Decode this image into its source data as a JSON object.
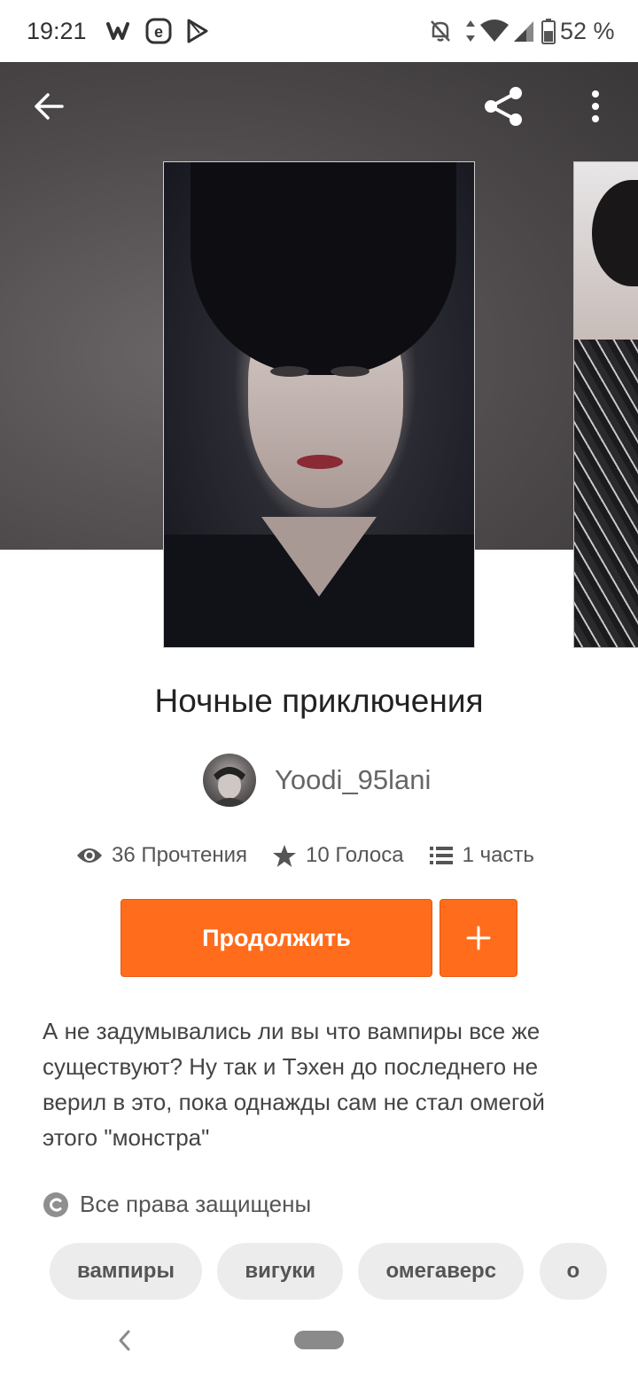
{
  "status_bar": {
    "time": "19:21",
    "battery": "52 %",
    "icons": [
      "wattpad-icon",
      "e-app-icon",
      "play-store-icon",
      "bell-off-icon",
      "data-arrows-icon",
      "wifi-icon",
      "signal-icon",
      "battery-icon"
    ]
  },
  "header": {
    "back_icon": "arrow-left-icon",
    "share_icon": "share-icon",
    "menu_icon": "more-vertical-icon"
  },
  "story": {
    "title": "Ночные приключения",
    "author": "Yoodi_95lani",
    "stats": {
      "reads": "36 Прочтения",
      "votes": "10 Голоса",
      "parts": "1 часть"
    },
    "continue_label": "Продолжить",
    "add_label": "+",
    "description": "А не задумывались ли вы что вампиры все же существуют? Ну так и Тэхен до последнего не верил в это, пока однажды сам не стал омегой этого \"монстра\"",
    "copyright": "Все права защищены",
    "tags": [
      "вампиры",
      "вигуки",
      "омегаверс",
      "о"
    ]
  },
  "colors": {
    "accent": "#ff6c1c",
    "tag_bg": "#ececec",
    "text": "#222222"
  }
}
